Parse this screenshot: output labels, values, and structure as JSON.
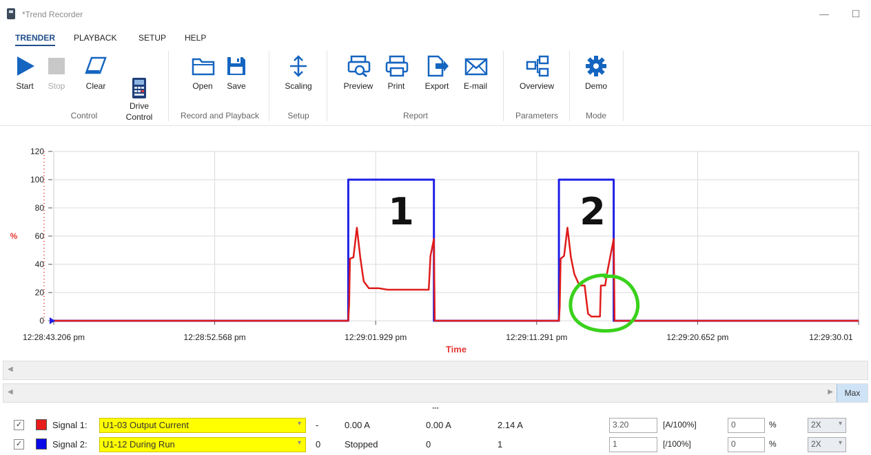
{
  "window": {
    "title": "*Trend Recorder",
    "minimize": "—",
    "maximize": "☐"
  },
  "menu_tabs": [
    "TRENDER",
    "PLAYBACK",
    "SETUP",
    "HELP"
  ],
  "ribbon": {
    "groups": [
      {
        "label": "Control",
        "buttons": [
          "Start",
          "Stop",
          "Clear",
          "Drive\nControl"
        ]
      },
      {
        "label": "Record and Playback",
        "buttons": [
          "Open",
          "Save"
        ]
      },
      {
        "label": "Setup",
        "buttons": [
          "Scaling"
        ]
      },
      {
        "label": "Report",
        "buttons": [
          "Preview",
          "Print",
          "Export",
          "E-mail"
        ]
      },
      {
        "label": "Parameters",
        "buttons": [
          "Overview"
        ]
      },
      {
        "label": "Mode",
        "buttons": [
          "Demo"
        ]
      }
    ]
  },
  "chart_data": {
    "type": "line",
    "xlabel": "Time",
    "ylabel": "%",
    "ylim": [
      0,
      120
    ],
    "yticks": [
      0,
      20,
      40,
      60,
      80,
      100,
      120
    ],
    "xticks": [
      "12:28:43.206 pm",
      "12:28:52.568 pm",
      "12:29:01.929 pm",
      "12:29:11.291 pm",
      "12:29:20.652 pm",
      "12:29:30.01"
    ],
    "grid": true,
    "series": [
      {
        "name": "U1-12 During Run",
        "color": "#1f1fe6",
        "points": [
          [
            0,
            0
          ],
          [
            17.2,
            0
          ],
          [
            17.2,
            100
          ],
          [
            22.2,
            100
          ],
          [
            22.2,
            0
          ],
          [
            29.5,
            0
          ],
          [
            29.5,
            100
          ],
          [
            32.7,
            100
          ],
          [
            32.7,
            0
          ],
          [
            47,
            0
          ]
        ]
      },
      {
        "name": "U1-03 Output Current",
        "color": "#e01b1b",
        "points": [
          [
            0,
            0
          ],
          [
            17.2,
            0
          ],
          [
            17.25,
            12
          ],
          [
            17.3,
            44
          ],
          [
            17.5,
            45
          ],
          [
            17.7,
            66
          ],
          [
            17.9,
            45
          ],
          [
            18.1,
            28
          ],
          [
            18.4,
            23
          ],
          [
            19,
            23
          ],
          [
            19.5,
            22
          ],
          [
            21.9,
            22
          ],
          [
            22.0,
            46
          ],
          [
            22.2,
            58
          ],
          [
            22.25,
            0
          ],
          [
            29.5,
            0
          ],
          [
            29.55,
            10
          ],
          [
            29.6,
            44
          ],
          [
            29.8,
            46
          ],
          [
            30.0,
            66
          ],
          [
            30.2,
            45
          ],
          [
            30.4,
            33
          ],
          [
            30.7,
            25
          ],
          [
            31.0,
            25
          ],
          [
            31.2,
            5
          ],
          [
            31.4,
            3
          ],
          [
            31.9,
            3
          ],
          [
            31.95,
            25
          ],
          [
            32.2,
            25
          ],
          [
            32.3,
            33
          ],
          [
            32.7,
            58
          ],
          [
            32.75,
            0
          ],
          [
            47,
            0
          ]
        ]
      }
    ],
    "annotations": [
      "1",
      "2"
    ]
  },
  "scrollbars": {
    "max_label": "Max"
  },
  "signals": [
    {
      "checked": "✓",
      "label": "Signal 1:",
      "color": "#e81c1c",
      "parameter": "U1-03 Output Current",
      "dash": "-",
      "value1": "0.00 A",
      "value2": "0.00 A",
      "value3": "2.14 A",
      "scale": "3.20",
      "unit": "[A/100%]",
      "offset": "0",
      "offset_unit": "%",
      "zoom": "2X"
    },
    {
      "checked": "✓",
      "label": "Signal 2:",
      "color": "#0a0ae6",
      "parameter": "U1-12 During Run",
      "dash": "0",
      "value1": "Stopped",
      "value2": "0",
      "value3": "1",
      "scale": "1",
      "unit": "[/100%]",
      "offset": "0",
      "offset_unit": "%",
      "zoom": "2X"
    }
  ]
}
